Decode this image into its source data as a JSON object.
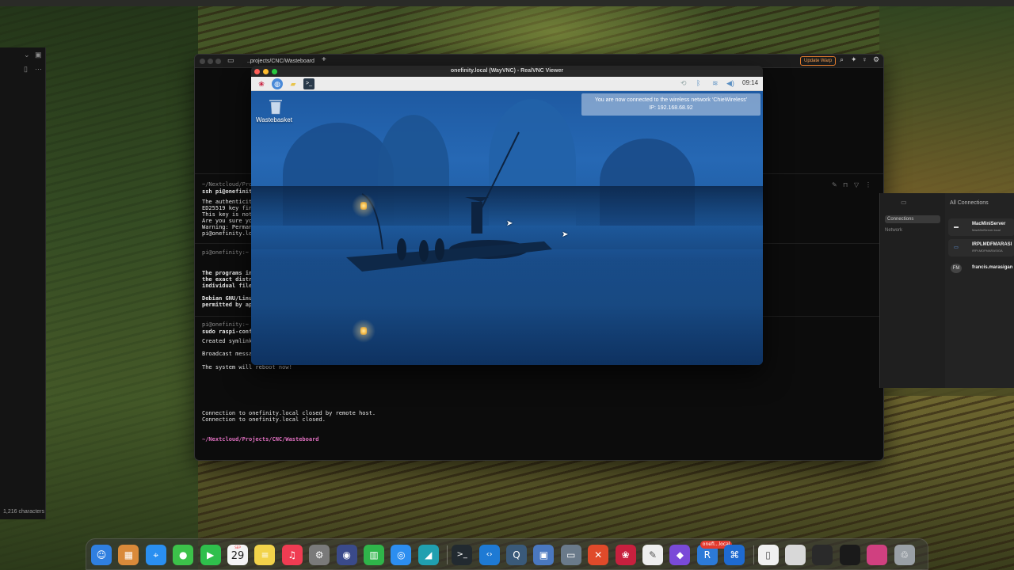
{
  "left_panel": {
    "status_text": "1,216 characters"
  },
  "warp": {
    "tab_title": "..projects/CNC/Wasteboard",
    "new_tab": "+",
    "update_button": "Update Warp",
    "icons": [
      "search-icon",
      "pin-icon",
      "lightbulb-icon",
      "settings-icon"
    ],
    "lines": [
      {
        "text": "~/Nextcloud/Projects/",
        "style": "dim"
      },
      {
        "text": "ssh pi@onefinity",
        "style": "bold"
      },
      {
        "text": "The authenticity",
        "style": "normal"
      },
      {
        "text": "ED25519 key fing",
        "style": "normal"
      },
      {
        "text": "This key is not ",
        "style": "normal"
      },
      {
        "text": "Are you sure you",
        "style": "normal"
      },
      {
        "text": "Warning: Perman",
        "style": "normal"
      },
      {
        "text": "pi@onefinity.loc",
        "style": "normal"
      },
      {
        "text": "pi@onefinity:~ (0",
        "style": "dim"
      },
      {
        "text": "The programs inc",
        "style": "bold"
      },
      {
        "text": "the exact distri",
        "style": "bold"
      },
      {
        "text": "individual files",
        "style": "bold"
      },
      {
        "text": "Debian GNU/Linux",
        "style": "bold"
      },
      {
        "text": "permitted by app",
        "style": "bold"
      },
      {
        "text": "pi@onefinity:~ (4",
        "style": "dim"
      },
      {
        "text": "sudo raspi-conf",
        "style": "bold"
      },
      {
        "text": "Created symlink ",
        "style": "normal"
      },
      {
        "text": "Broadcast messag",
        "style": "normal"
      },
      {
        "text": "The system will reboot now!",
        "style": "normal"
      },
      {
        "text": "Connection to onefinity.local closed by remote host.",
        "style": "normal"
      },
      {
        "text": "Connection to onefinity.local closed.",
        "style": "normal"
      },
      {
        "text": "~/Nextcloud/Projects/CNC/Wasteboard",
        "style": "pink"
      }
    ]
  },
  "connections": {
    "sidebar_items": [
      "Connections",
      "Network"
    ],
    "header": "All Connections",
    "items": [
      {
        "name": "MacMiniServer",
        "sub": "MacMiniServer.local",
        "icon": "monitor-icon"
      },
      {
        "name": "IRPLMDFMARASI",
        "sub": "IRPLMDFMARASIGA",
        "icon": "laptop-icon"
      },
      {
        "name": "francis.marasigan",
        "sub": "",
        "icon": "FM"
      }
    ]
  },
  "vnc": {
    "window_title": "onefinity.local (WayVNC) - RealVNC Viewer",
    "clock": "09:14",
    "trash_label": "Wastebasket",
    "notification_line1": "You are now connected to the wireless network ‘ChieWireless’",
    "notification_line2": "IP: 192.168.68.92"
  },
  "dock": {
    "calendar_month": "SEP",
    "calendar_day": "29",
    "badge_text": "onefi...local",
    "items": [
      {
        "name": "finder-icon",
        "glyph": "☺",
        "color": "#2f7fe0"
      },
      {
        "name": "launchpad-icon",
        "glyph": "▦",
        "color": "#d98a3a"
      },
      {
        "name": "safari-icon",
        "glyph": "⌖",
        "color": "#2a8ff0"
      },
      {
        "name": "messages-icon",
        "glyph": "●",
        "color": "#3cc24a"
      },
      {
        "name": "facetime-icon",
        "glyph": "▶",
        "color": "#2fbf4c"
      },
      {
        "name": "calendar-icon",
        "glyph": "",
        "color": "#f4f4f4"
      },
      {
        "name": "notes-icon",
        "glyph": "≡",
        "color": "#f2d34a"
      },
      {
        "name": "music-icon",
        "glyph": "♫",
        "color": "#f03c52"
      },
      {
        "name": "system-settings-icon",
        "glyph": "⚙",
        "color": "#7a7a7a"
      },
      {
        "name": "davinci-resolve-icon",
        "glyph": "◉",
        "color": "#3a4a8a"
      },
      {
        "name": "numbers-icon",
        "glyph": "▥",
        "color": "#2fb54a"
      },
      {
        "name": "signal-icon",
        "glyph": "◎",
        "color": "#2c8ef0"
      },
      {
        "name": "copilot-icon",
        "glyph": "◢",
        "color": "#20a0b0"
      },
      {
        "name": "terminal-icon",
        "glyph": ">_",
        "color": "#222a30"
      },
      {
        "name": "vscode-icon",
        "glyph": "‹›",
        "color": "#1e7ad4"
      },
      {
        "name": "quicktime-icon",
        "glyph": "Q",
        "color": "#3a5a7a"
      },
      {
        "name": "preview-icon",
        "glyph": "▣",
        "color": "#4a78c0"
      },
      {
        "name": "disk-utility-icon",
        "glyph": "▭",
        "color": "#6a7a8a"
      },
      {
        "name": "reeder-icon",
        "glyph": "✕",
        "color": "#e04a2a"
      },
      {
        "name": "raspberry-pi-imager-icon",
        "glyph": "❀",
        "color": "#c8203e"
      },
      {
        "name": "textedit-icon",
        "glyph": "✎",
        "color": "#eeeeee"
      },
      {
        "name": "obsidian-icon",
        "glyph": "◆",
        "color": "#7a4ad8"
      },
      {
        "name": "realvnc-icon",
        "glyph": "R",
        "color": "#2c7ad8"
      },
      {
        "name": "remote-desktop-icon",
        "glyph": "⌘",
        "color": "#1e6ad0"
      },
      {
        "name": "document-icon",
        "glyph": "▯",
        "color": "#f0f0f0"
      },
      {
        "name": "window-thumb-icon",
        "glyph": "",
        "color": "#d8d8d8"
      },
      {
        "name": "window-thumb-icon-2",
        "glyph": "",
        "color": "#2a2a2a"
      },
      {
        "name": "window-thumb-icon-3",
        "glyph": "",
        "color": "#1a1a1a"
      },
      {
        "name": "window-thumb-icon-4",
        "glyph": "",
        "color": "#d04080"
      },
      {
        "name": "trash-icon",
        "glyph": "♲",
        "color": "#9aa0a6"
      }
    ]
  }
}
